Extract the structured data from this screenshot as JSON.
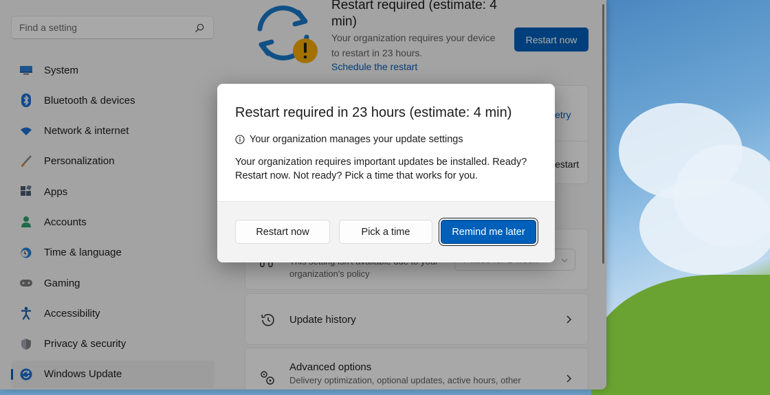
{
  "search": {
    "placeholder": "Find a setting"
  },
  "sidebar": {
    "items": [
      {
        "label": "System",
        "icon": "monitor-icon"
      },
      {
        "label": "Bluetooth & devices",
        "icon": "bluetooth-icon"
      },
      {
        "label": "Network & internet",
        "icon": "wifi-icon"
      },
      {
        "label": "Personalization",
        "icon": "brush-icon"
      },
      {
        "label": "Apps",
        "icon": "apps-icon"
      },
      {
        "label": "Accounts",
        "icon": "person-icon"
      },
      {
        "label": "Time & language",
        "icon": "clock-globe-icon"
      },
      {
        "label": "Gaming",
        "icon": "controller-icon"
      },
      {
        "label": "Accessibility",
        "icon": "accessibility-icon"
      },
      {
        "label": "Privacy & security",
        "icon": "shield-icon"
      },
      {
        "label": "Windows Update",
        "icon": "update-icon",
        "active": true
      }
    ]
  },
  "banner": {
    "title": "Restart required (estimate: 4 min)",
    "description": "Your organization requires your device to restart in 23 hours.",
    "link": "Schedule the restart",
    "button": "Restart now"
  },
  "cards": {
    "retry_label": "Retry",
    "restart_label": "Restart",
    "pause": {
      "subtitle": "This setting isn't available due to your organization's policy",
      "dropdown": "Pause for 1 week"
    },
    "history": {
      "title": "Update history"
    },
    "advanced": {
      "title": "Advanced options",
      "subtitle": "Delivery optimization, optional updates, active hours, other"
    }
  },
  "dialog": {
    "title": "Restart required in 23 hours (estimate: 4 min)",
    "info": "Your organization manages your update settings",
    "body": "Your organization requires important updates be installed. Ready? Restart now. Not ready? Pick a time that works for you.",
    "buttons": {
      "restart_now": "Restart now",
      "pick_time": "Pick a time",
      "remind_later": "Remind me later"
    }
  },
  "colors": {
    "accent": "#005fb8",
    "warning": "#f2a900",
    "sync_blue": "#1a78c8"
  }
}
